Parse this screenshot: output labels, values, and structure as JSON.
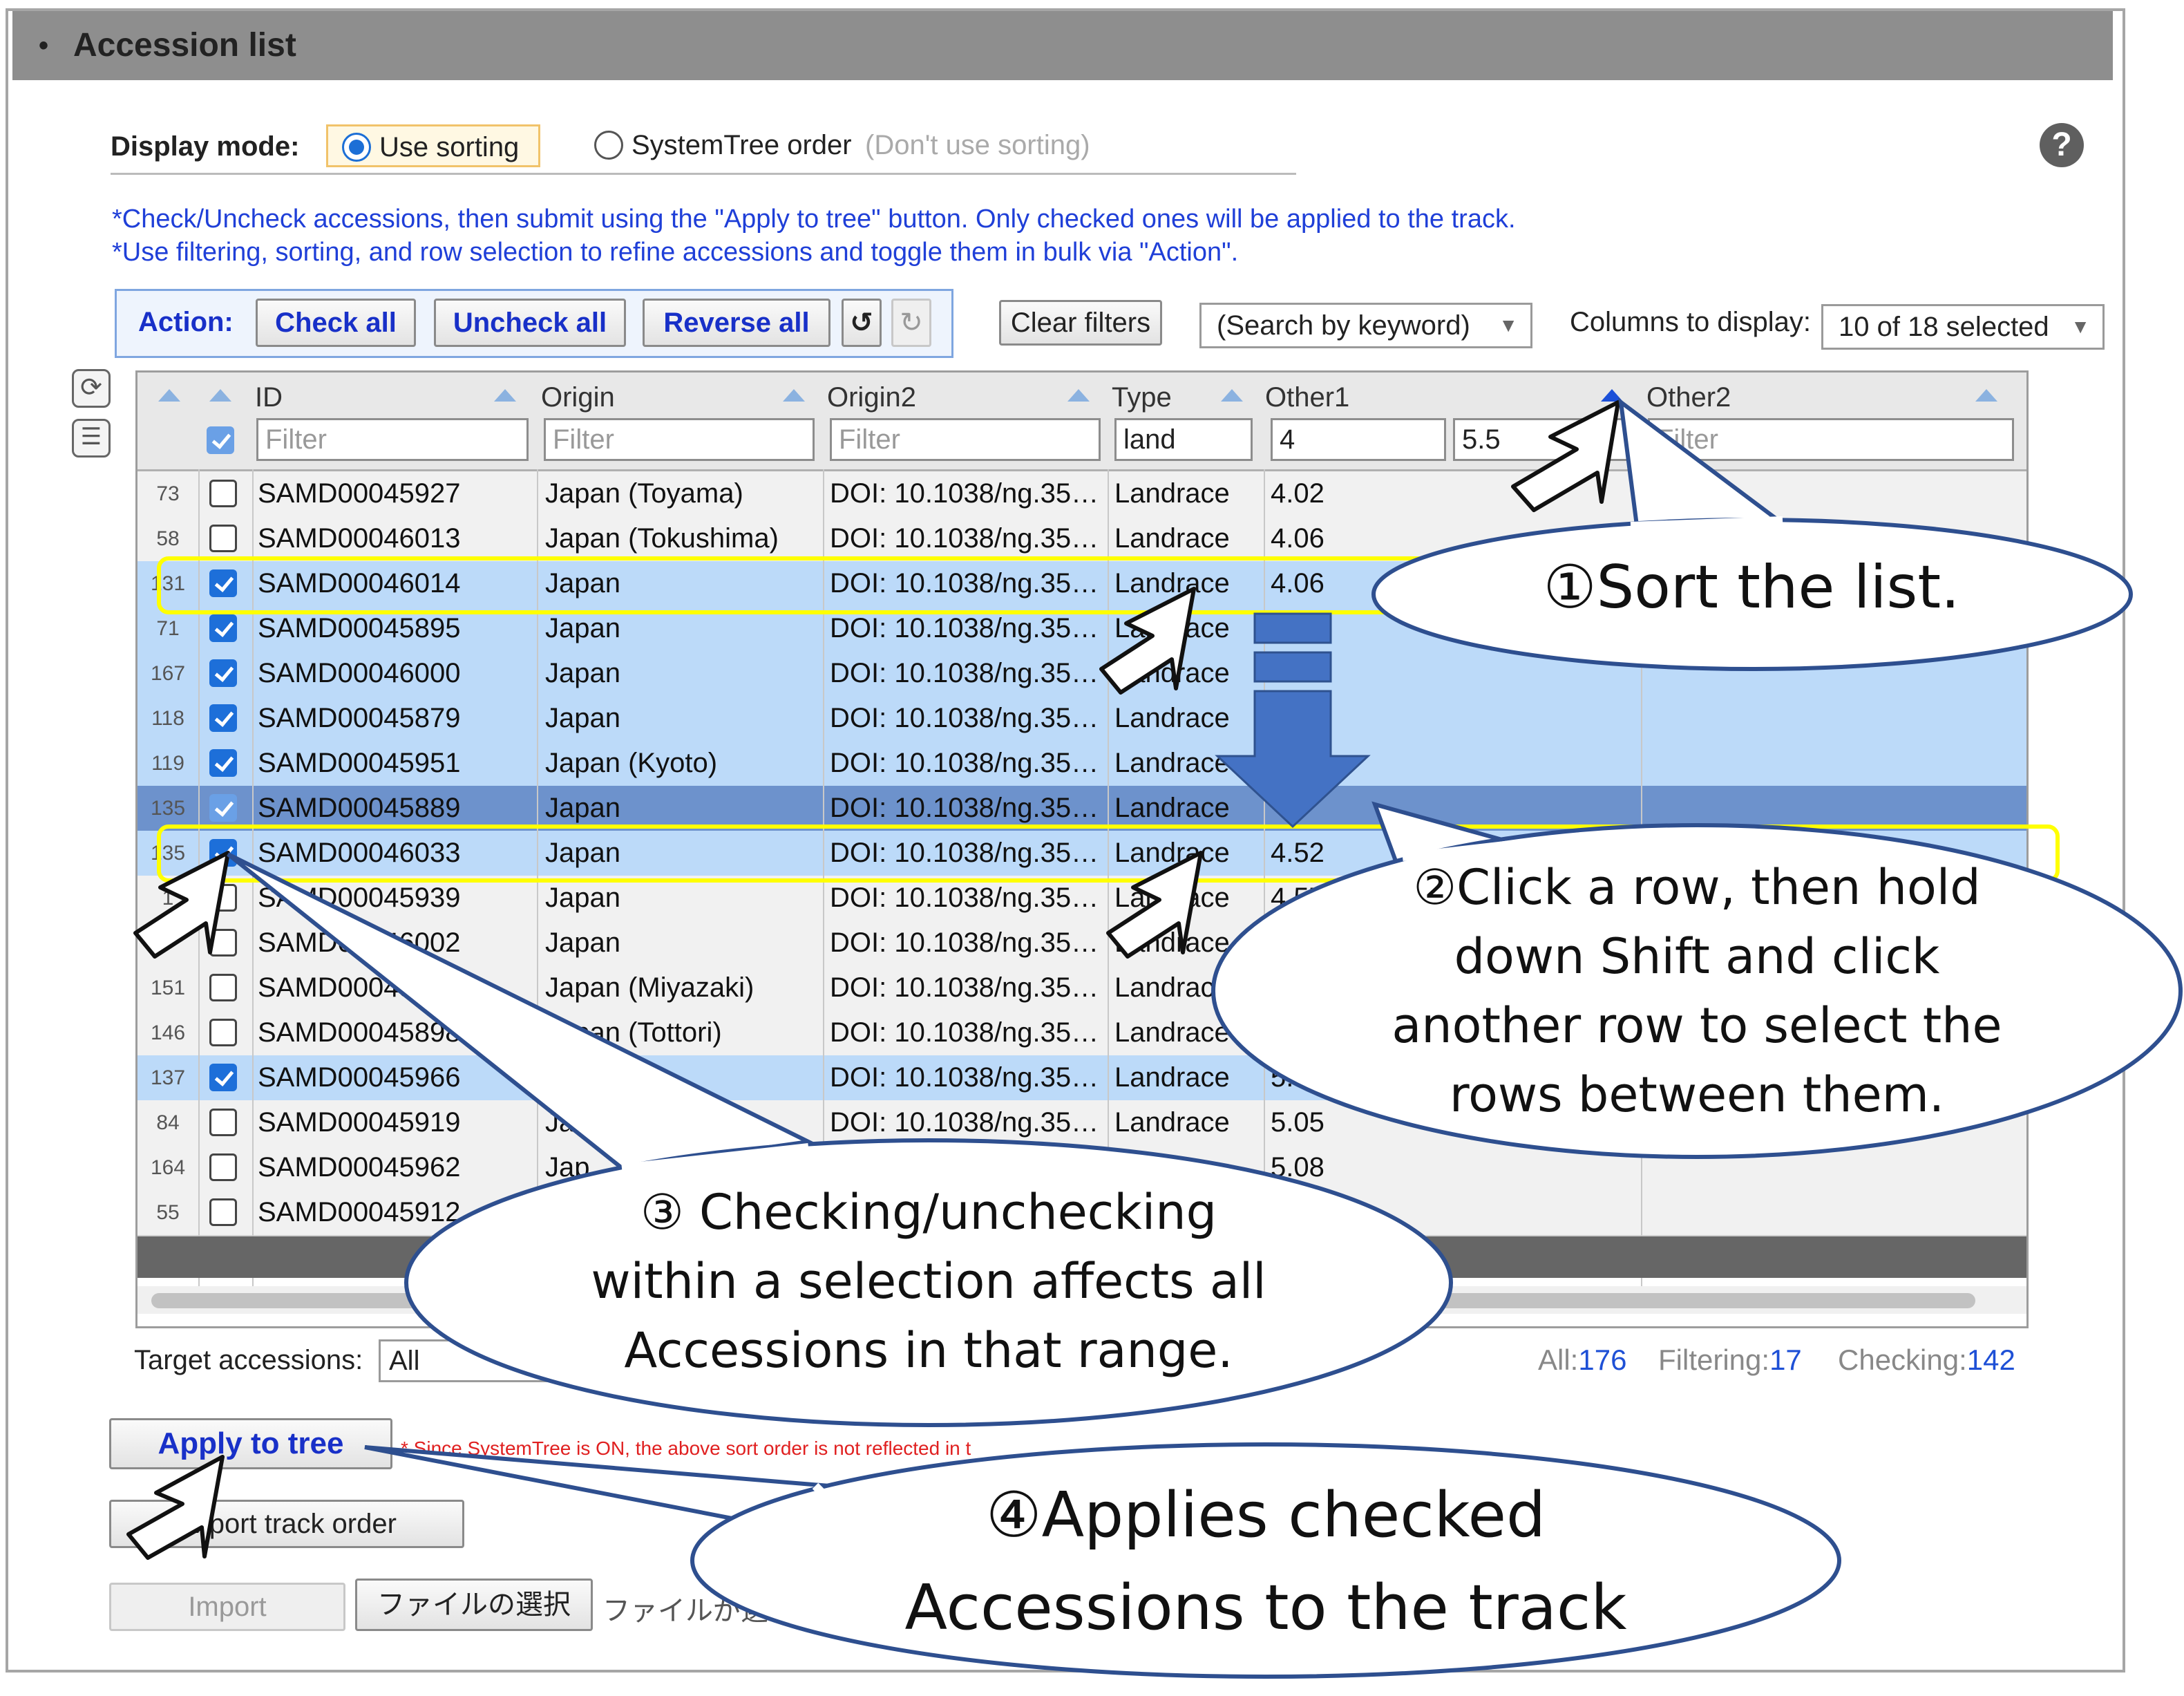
{
  "panel": {
    "bullet": "•",
    "title": "Accession list"
  },
  "display_mode": {
    "label": "Display mode:",
    "option1": "Use sorting",
    "option2": "SystemTree order",
    "option2_hint": "(Don't use sorting)",
    "help": "?"
  },
  "notes": [
    "*Check/Uncheck accessions, then submit using the \"Apply to tree\" button. Only checked ones will be applied to the track.",
    "*Use filtering, sorting, and row selection to refine accessions and toggle them in bulk via \"Action\"."
  ],
  "actions": {
    "label": "Action:",
    "check_all": "Check all",
    "uncheck_all": "Uncheck all",
    "reverse_all": "Reverse all",
    "clear_filters": "Clear filters",
    "search_placeholder": "(Search by keyword)",
    "columns_label": "Columns to display:",
    "columns_value": "10 of 18 selected"
  },
  "columns": {
    "id": "ID",
    "origin": "Origin",
    "origin2": "Origin2",
    "type": "Type",
    "other1": "Other1",
    "other2": "Other2"
  },
  "filters": {
    "id": "Filter",
    "origin": "Filter",
    "origin2": "Filter",
    "type": "land",
    "other1_min": "4",
    "other1_max": "5.5",
    "other2": "Filter"
  },
  "rows": [
    {
      "n": "73",
      "id": "SAMD00045927",
      "origin": "Japan (Toyama)",
      "origin2": "DOI: 10.1038/ng.35…",
      "type": "Landrace",
      "other1": "4.02"
    },
    {
      "n": "58",
      "id": "SAMD00046013",
      "origin": "Japan (Tokushima)",
      "origin2": "DOI: 10.1038/ng.35…",
      "type": "Landrace",
      "other1": "4.06"
    },
    {
      "n": "131",
      "id": "SAMD00046014",
      "origin": "Japan",
      "origin2": "DOI: 10.1038/ng.35…",
      "type": "Landrace",
      "other1": "4.06"
    },
    {
      "n": "71",
      "id": "SAMD00045895",
      "origin": "Japan",
      "origin2": "DOI: 10.1038/ng.35…",
      "type": "Landrace",
      "other1": ""
    },
    {
      "n": "167",
      "id": "SAMD00046000",
      "origin": "Japan",
      "origin2": "DOI: 10.1038/ng.35…",
      "type": "Landrace",
      "other1": ""
    },
    {
      "n": "118",
      "id": "SAMD00045879",
      "origin": "Japan",
      "origin2": "DOI: 10.1038/ng.35…",
      "type": "Landrace",
      "other1": ""
    },
    {
      "n": "119",
      "id": "SAMD00045951",
      "origin": "Japan (Kyoto)",
      "origin2": "DOI: 10.1038/ng.35…",
      "type": "Landrace",
      "other1": ""
    },
    {
      "n": "135",
      "id": "SAMD00045889",
      "origin": "Japan",
      "origin2": "DOI: 10.1038/ng.35…",
      "type": "Landrace",
      "other1": ""
    },
    {
      "n": "135",
      "id": "SAMD00046033",
      "origin": "Japan",
      "origin2": "DOI: 10.1038/ng.35…",
      "type": "Landrace",
      "other1": "4.52"
    },
    {
      "n": "1",
      "id": "SAMD00045939",
      "origin": "Japan",
      "origin2": "DOI: 10.1038/ng.35…",
      "type": "Landrace",
      "other1": "4.57"
    },
    {
      "n": "",
      "id": "SAMD00046002",
      "origin": "Japan",
      "origin2": "DOI: 10.1038/ng.35…",
      "type": "Landrace",
      "other1": ""
    },
    {
      "n": "151",
      "id": "SAMD00045",
      "origin": "Japan (Miyazaki)",
      "origin2": "DOI: 10.1038/ng.35…",
      "type": "Landrace",
      "other1": ""
    },
    {
      "n": "146",
      "id": "SAMD00045898",
      "origin": "Japan (Tottori)",
      "origin2": "DOI: 10.1038/ng.35…",
      "type": "Landrace",
      "other1": ""
    },
    {
      "n": "137",
      "id": "SAMD00045966",
      "origin": "",
      "origin2": "DOI: 10.1038/ng.35…",
      "type": "Landrace",
      "other1": "5."
    },
    {
      "n": "84",
      "id": "SAMD00045919",
      "origin": "Ja",
      "origin2": "DOI: 10.1038/ng.35…",
      "type": "Landrace",
      "other1": "5.05"
    },
    {
      "n": "164",
      "id": "SAMD00045962",
      "origin": "Jap",
      "origin2": "",
      "type": "",
      "other1": "5.08"
    },
    {
      "n": "55",
      "id": "SAMD00045912",
      "origin": "",
      "origin2": "",
      "type": "",
      "other1": ""
    }
  ],
  "footer": {
    "target_label": "Target accessions:",
    "target_value": "All",
    "all_label": "All:",
    "all_value": "176",
    "filtering_label": "Filtering:",
    "filtering_value": "17",
    "checking_label": "Checking:",
    "checking_value": "142",
    "apply": "Apply to tree",
    "apply_note": "* Since SystemTree is ON, the above sort order is not reflected in t",
    "export": "Export track order",
    "import": "Import",
    "file_button": "ファイルの選択",
    "file_status": "ファイルが選"
  },
  "callouts": {
    "c1": "①Sort the list.",
    "c2": [
      "②Click a row, then hold",
      "down Shift and click",
      "another row to select the",
      "rows between them."
    ],
    "c3": [
      "③ Checking/unchecking",
      "within a selection affects all",
      "Accessions in that range."
    ],
    "c4": [
      "④Applies checked",
      "Accessions to the track"
    ]
  },
  "colors": {
    "selected_row": "#bcdaf9",
    "current_row": "#6d92cc",
    "accent_blue": "#1d6fd9",
    "highlight": "#ffff00",
    "callout_border": "#2e4f8f"
  }
}
